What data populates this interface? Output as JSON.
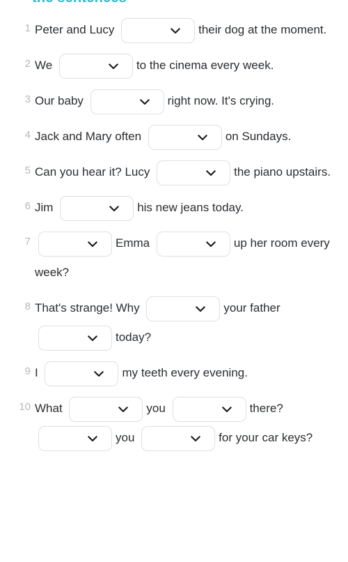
{
  "heading": {
    "text": "the sentences",
    "color": "#2bb8cd"
  },
  "theme": {
    "background": "#ffffff",
    "text_color": "#2a2d31",
    "number_color": "#b4b8bd",
    "select_border": "#dcdfe3",
    "chevron_color": "#15181c"
  },
  "icons": {
    "chevron_down": "chevron-down-icon"
  },
  "select_placeholder": "",
  "exercises": [
    {
      "number": "1",
      "parts": [
        {
          "type": "text",
          "value": "Peter and Lucy"
        },
        {
          "type": "select",
          "value": ""
        },
        {
          "type": "text",
          "value": "their dog at the moment."
        }
      ]
    },
    {
      "number": "2",
      "parts": [
        {
          "type": "text",
          "value": "We"
        },
        {
          "type": "select",
          "value": ""
        },
        {
          "type": "text",
          "value": "to the cinema every week."
        }
      ]
    },
    {
      "number": "3",
      "parts": [
        {
          "type": "text",
          "value": "Our baby"
        },
        {
          "type": "select",
          "value": ""
        },
        {
          "type": "text",
          "value": "right now. It's crying."
        }
      ]
    },
    {
      "number": "4",
      "parts": [
        {
          "type": "text",
          "value": "Jack and Mary often"
        },
        {
          "type": "select",
          "value": ""
        },
        {
          "type": "text",
          "value": "on Sundays."
        }
      ]
    },
    {
      "number": "5",
      "parts": [
        {
          "type": "text",
          "value": "Can you hear it? Lucy"
        },
        {
          "type": "select",
          "value": ""
        },
        {
          "type": "text",
          "value": "the piano upstairs."
        }
      ]
    },
    {
      "number": "6",
      "parts": [
        {
          "type": "text",
          "value": "Jim"
        },
        {
          "type": "select",
          "value": ""
        },
        {
          "type": "text",
          "value": "his new jeans today."
        }
      ]
    },
    {
      "number": "7",
      "parts": [
        {
          "type": "select",
          "value": ""
        },
        {
          "type": "text",
          "value": "Emma"
        },
        {
          "type": "select",
          "value": ""
        },
        {
          "type": "text",
          "value": "up her room every week?"
        }
      ]
    },
    {
      "number": "8",
      "parts": [
        {
          "type": "text",
          "value": "That's strange! Why"
        },
        {
          "type": "select",
          "value": ""
        },
        {
          "type": "text",
          "value": "your father"
        },
        {
          "type": "select",
          "value": ""
        },
        {
          "type": "text",
          "value": "today?"
        }
      ]
    },
    {
      "number": "9",
      "parts": [
        {
          "type": "text",
          "value": "I"
        },
        {
          "type": "select",
          "value": ""
        },
        {
          "type": "text",
          "value": "my teeth every evening."
        }
      ]
    },
    {
      "number": "10",
      "parts": [
        {
          "type": "text",
          "value": "What"
        },
        {
          "type": "select",
          "value": ""
        },
        {
          "type": "text",
          "value": "you"
        },
        {
          "type": "select",
          "value": ""
        },
        {
          "type": "text",
          "value": "there?"
        },
        {
          "type": "select",
          "value": ""
        },
        {
          "type": "text",
          "value": "you"
        },
        {
          "type": "select",
          "value": ""
        },
        {
          "type": "text",
          "value": "for your car keys?"
        }
      ]
    }
  ]
}
